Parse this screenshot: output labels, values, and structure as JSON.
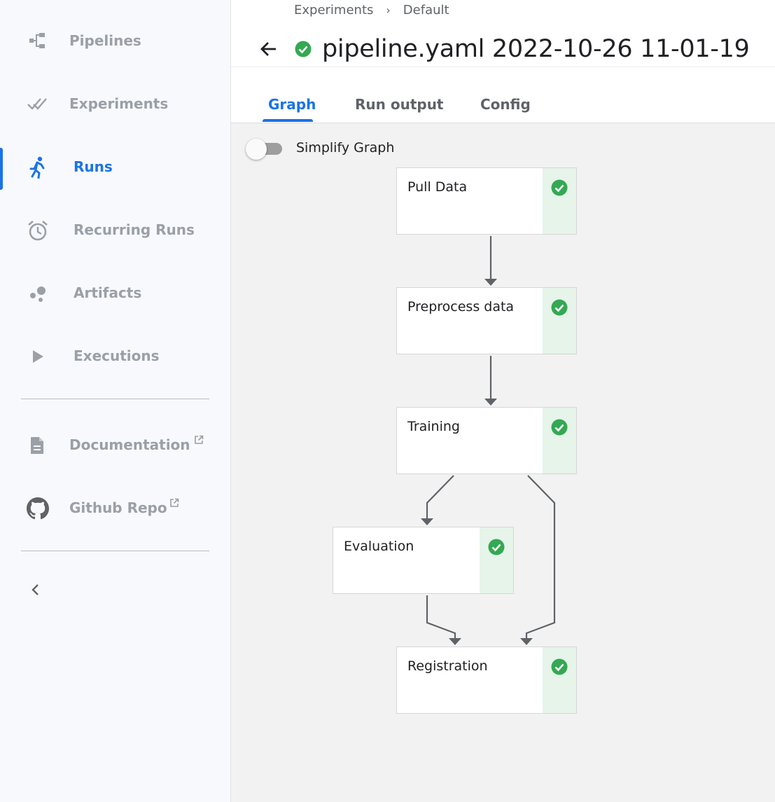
{
  "sidebar": {
    "items": [
      {
        "label": "Pipelines",
        "icon": "pipelines-icon"
      },
      {
        "label": "Experiments",
        "icon": "experiments-icon"
      },
      {
        "label": "Runs",
        "icon": "runs-icon",
        "active": true
      },
      {
        "label": "Recurring Runs",
        "icon": "alarm-clock-icon"
      },
      {
        "label": "Artifacts",
        "icon": "artifacts-icon"
      },
      {
        "label": "Executions",
        "icon": "play-icon"
      }
    ],
    "links": [
      {
        "label": "Documentation",
        "icon": "document-icon",
        "external": true
      },
      {
        "label": "Github Repo",
        "icon": "github-icon",
        "external": true
      }
    ],
    "collapse_icon": "chevron-left-icon"
  },
  "breadcrumb": {
    "items": [
      "Experiments",
      "Default"
    ],
    "separator": "›"
  },
  "header": {
    "title": "pipeline.yaml 2022-10-26 11-01-19",
    "status": "succeeded",
    "back_icon": "arrow-left-icon"
  },
  "tabs": [
    {
      "label": "Graph",
      "active": true
    },
    {
      "label": "Run output"
    },
    {
      "label": "Config"
    }
  ],
  "graph": {
    "simplify_toggle": {
      "label": "Simplify Graph",
      "on": false
    },
    "nodes": [
      {
        "label": "Pull Data",
        "status": "succeeded"
      },
      {
        "label": "Preprocess data",
        "status": "succeeded"
      },
      {
        "label": "Training",
        "status": "succeeded"
      },
      {
        "label": "Evaluation",
        "status": "succeeded"
      },
      {
        "label": "Registration",
        "status": "succeeded"
      }
    ],
    "edges": [
      [
        "Pull Data",
        "Preprocess data"
      ],
      [
        "Preprocess data",
        "Training"
      ],
      [
        "Training",
        "Evaluation"
      ],
      [
        "Training",
        "Registration"
      ],
      [
        "Evaluation",
        "Registration"
      ]
    ]
  },
  "colors": {
    "accent": "#1a73e8",
    "success": "#34a853",
    "success_bg": "#e6f4ea",
    "canvas": "#f2f2f2",
    "sidebar_text": "#9aa0a6"
  }
}
